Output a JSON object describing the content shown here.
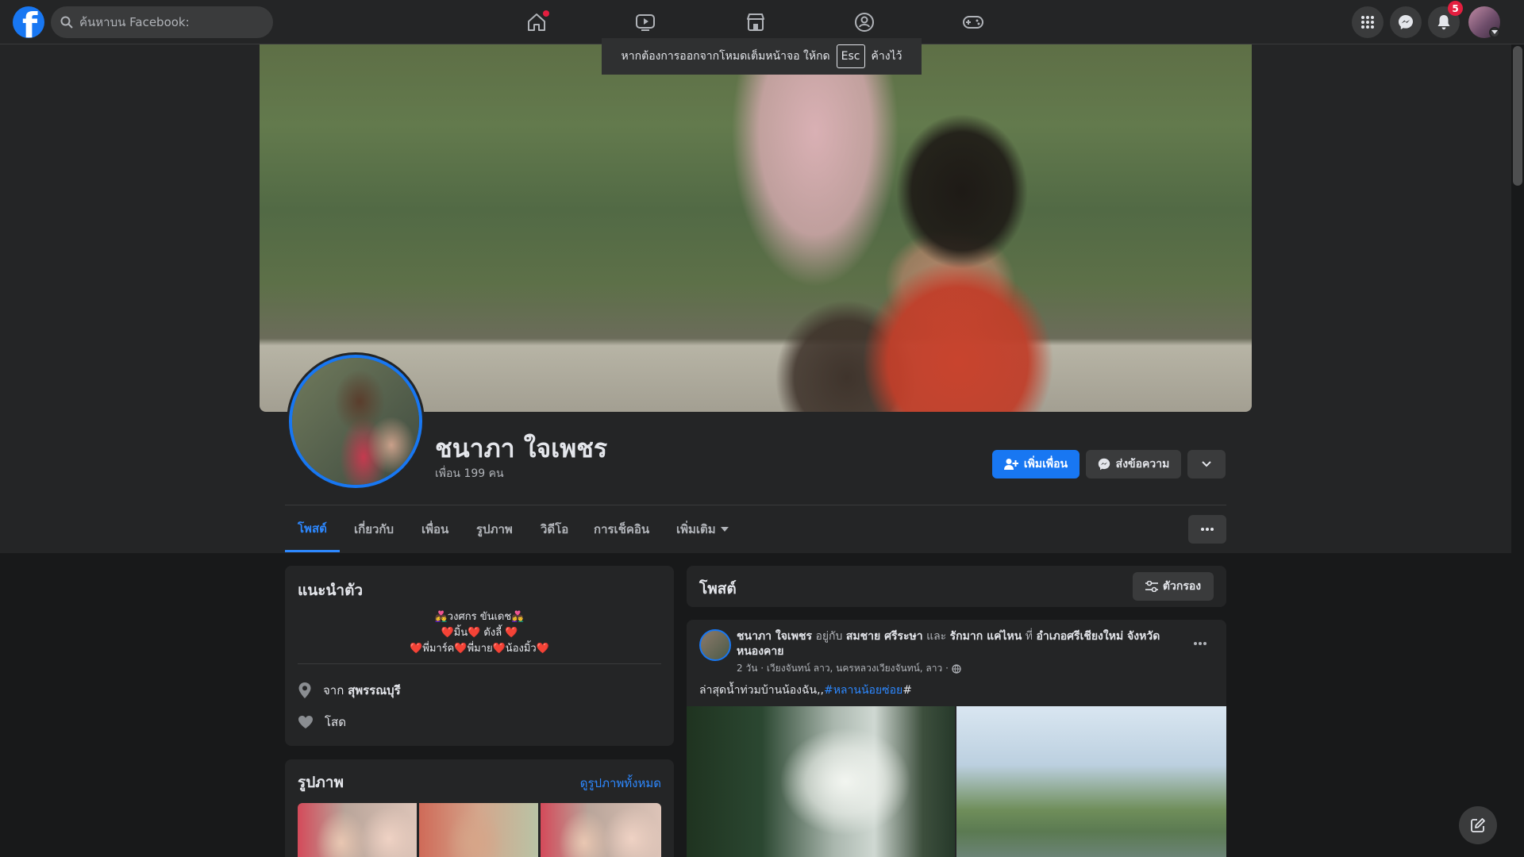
{
  "nav": {
    "search_placeholder": "ค้นหาบน Facebook:",
    "notification_count": "5"
  },
  "toast": {
    "text_before": "หากต้องการออกจากโหมดเต็มหน้าจอ ให้กด",
    "key": "Esc",
    "text_after": "ค้างไว้"
  },
  "profile": {
    "name": "ชนาภา ใจเพชร",
    "friends": "เพื่อน 199 คน",
    "add_friend": "เพิ่มเพื่อน",
    "message": "ส่งข้อความ"
  },
  "tabs": [
    "โพสต์",
    "เกี่ยวกับ",
    "เพื่อน",
    "รูปภาพ",
    "วิดีโอ",
    "การเช็คอิน",
    "เพิ่มเติม"
  ],
  "intro": {
    "title": "แนะนำตัว",
    "bio": [
      "👩‍❤️‍👨วงศกร ขันเดช👩‍❤️‍👨",
      "❤️มิ้น❤️ ดังลี้ ❤️",
      "❤️พี่มาร์ค❤️พี่มาย❤️น้องมิ้ว❤️"
    ],
    "from_prefix": "จาก",
    "from_place": "สุพรรณบุรี",
    "relationship": "โสด"
  },
  "photos": {
    "title": "รูปภาพ",
    "see_all": "ดูรูปภาพทั้งหมด"
  },
  "posts": {
    "title": "โพสต์",
    "filter": "ตัวกรอง"
  },
  "post": {
    "author": "ชนาภา ใจเพชร",
    "with_word": "อยู่กับ",
    "tag1": "สมชาย ศรีระษา",
    "and_word": "และ",
    "tag2": "รักมาก แค่ไหน",
    "at_word": "ที่",
    "location": "อำเภอศรีเชียงใหม่ จังหวัดหนองคาย",
    "meta": "2 วัน · เวียงจันทน์ ลาว, นครหลวงเวียงจันทน์, ลาว ·",
    "text": "ล่าสุดน้ำท่วมบ้านน้องฉัน,,",
    "hashtag": "#หลานน้อยซ่อย",
    "text_end": "#"
  },
  "colors": {
    "accent": "#1877f2",
    "link": "#2d88ff",
    "badge": "#e41e3f"
  },
  "icons": [
    "facebook-logo-icon",
    "search-icon",
    "home-icon",
    "watch-icon",
    "marketplace-icon",
    "groups-icon",
    "gaming-icon",
    "menu-grid-icon",
    "messenger-icon",
    "bell-icon",
    "caret-down-icon",
    "add-friend-icon",
    "chevron-down-icon",
    "more-icon",
    "location-pin-icon",
    "heart-icon",
    "filter-icon",
    "globe-icon",
    "compose-icon"
  ]
}
